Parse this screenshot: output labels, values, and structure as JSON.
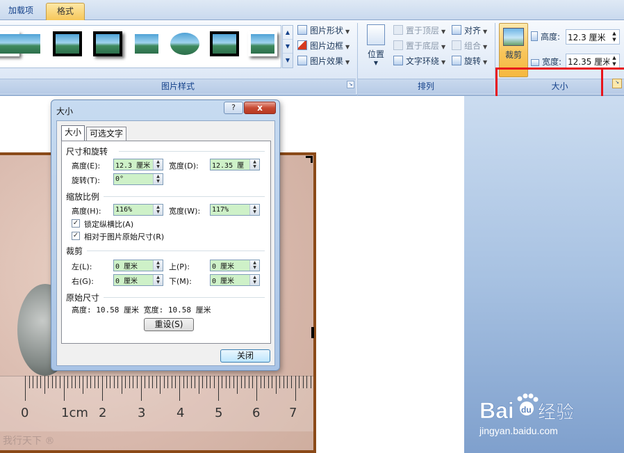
{
  "tabs": [
    {
      "label": "加载项",
      "active": false
    },
    {
      "label": "格式",
      "active": true
    }
  ],
  "ribbon": {
    "picture_styles": {
      "label": "图片样式",
      "buttons": {
        "shape": "图片形状",
        "border": "图片边框",
        "effects": "图片效果"
      }
    },
    "arrange": {
      "label": "排列",
      "position": "位置",
      "bring_front": "置于顶层",
      "send_back": "置于底层",
      "wrap": "文字环绕",
      "align": "对齐",
      "group": "组合",
      "rotate": "旋转"
    },
    "size": {
      "label": "大小",
      "crop": "裁剪",
      "height_label": "高度:",
      "height_value": "12.3 厘米",
      "width_label": "宽度:",
      "width_value": "12.35 厘米"
    }
  },
  "dialog": {
    "title": "大小",
    "help": "?",
    "close_x": "x",
    "tabs": [
      "大小",
      "可选文字"
    ],
    "rotate_section": {
      "title": "尺寸和旋转",
      "height_label": "高度(E):",
      "height_value": "12.3 厘米",
      "width_label": "宽度(D):",
      "width_value": "12.35 厘",
      "rotate_label": "旋转(T):",
      "rotate_value": "0°"
    },
    "scale_section": {
      "title": "缩放比例",
      "height_label": "高度(H):",
      "height_value": "116%",
      "width_label": "宽度(W):",
      "width_value": "117%",
      "lock_label": "锁定纵横比(A)",
      "lock_checked": true,
      "relative_label": "相对于图片原始尺寸(R)",
      "relative_checked": true
    },
    "crop_section": {
      "title": "裁剪",
      "left_label": "左(L):",
      "left_value": "0 厘米",
      "top_label": "上(P):",
      "top_value": "0 厘米",
      "right_label": "右(G):",
      "right_value": "0 厘米",
      "bottom_label": "下(M):",
      "bottom_value": "0 厘米"
    },
    "original": {
      "title": "原始尺寸",
      "text": "高度:  10.58 厘米  宽度:  10.58 厘米"
    },
    "reset_button": "重设(S)",
    "close_button": "关闭"
  },
  "document": {
    "ruler_numbers": [
      "0",
      "1cm",
      "2",
      "3",
      "4",
      "5",
      "6",
      "7"
    ],
    "watermark": "我行天下 ®"
  },
  "baidu": {
    "logo_text": "Baidu经验",
    "url": "jingyan.baidu.com"
  },
  "colors": {
    "highlight": "#e8141b",
    "active_tab": "#f6c75a",
    "field_green": "#cef1c8"
  }
}
